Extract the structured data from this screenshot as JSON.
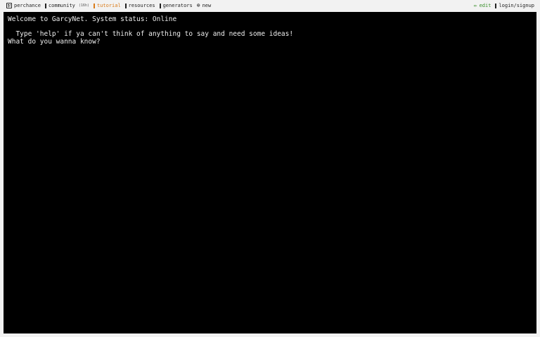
{
  "nav": {
    "brand": "perchance",
    "community": "community",
    "community_count": "(16h)",
    "tutorial": "tutorial",
    "resources": "resources",
    "generators": "generators",
    "new": "new",
    "edit": "edit",
    "login": "login/signup"
  },
  "icons": {
    "brand": "dice-icon",
    "community": "chat-icon",
    "tutorial": "book-icon",
    "resources": "book-icon",
    "generators": "list-icon",
    "new": "plus-circle-icon",
    "edit": "pencil-icon",
    "login": "user-icon"
  },
  "colors": {
    "active_tab": "#d97b1a",
    "edit": "#3a8f2c",
    "terminal_bg": "#000000",
    "terminal_fg": "#f0f0f0"
  },
  "terminal": {
    "line1": "Welcome to GarcyNet. System status: Online",
    "line2": "  Type 'help' if ya can't think of anything to say and need some ideas!",
    "line3": "What do you wanna know?"
  }
}
